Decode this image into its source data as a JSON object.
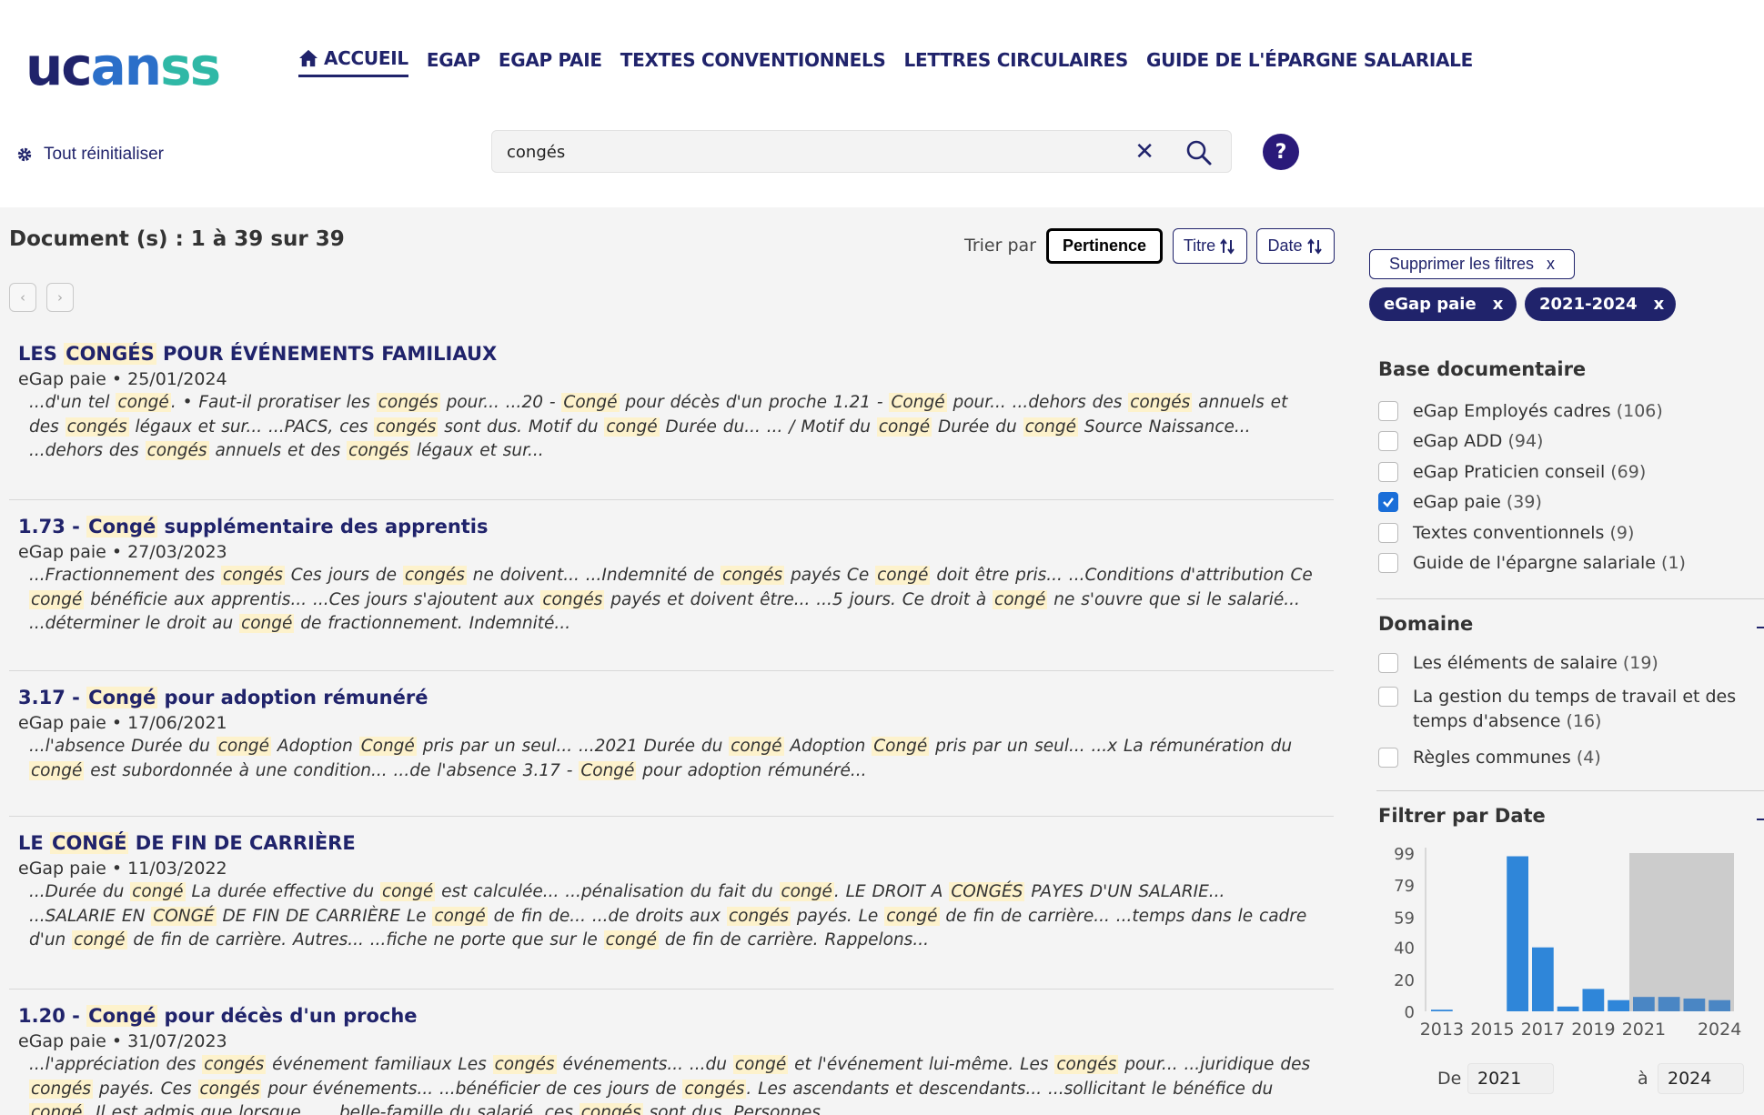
{
  "header": {
    "logo": {
      "part1": "uc",
      "part2": "an",
      "part3": "ss"
    },
    "nav": [
      {
        "label": "ACCUEIL",
        "active": true,
        "icon": "home-icon"
      },
      {
        "label": "EGAP"
      },
      {
        "label": "EGAP PAIE"
      },
      {
        "label": "TEXTES CONVENTIONNELS"
      },
      {
        "label": "LETTRES CIRCULAIRES"
      },
      {
        "label": "GUIDE DE L'ÉPARGNE SALARIALE"
      }
    ],
    "reset_label": "Tout réinitialiser",
    "search": {
      "value": "congés",
      "clear_symbol": "✕"
    },
    "help_symbol": "?"
  },
  "results_header": {
    "count_text": "Document (s) : 1 à 39 sur 39",
    "sort_label": "Trier par",
    "sort_options": [
      "Pertinence",
      "Titre",
      "Date"
    ],
    "sort_active": "Pertinence",
    "pager": {
      "prev": "‹",
      "next": "›"
    }
  },
  "results": [
    {
      "title": [
        {
          "t": "LES "
        },
        {
          "t": "CONGÉS",
          "h": true
        },
        {
          "t": " POUR ÉVÉNEMENTS FAMILIAUX"
        }
      ],
      "meta": "eGap paie • 25/01/2024",
      "snippet": [
        {
          "t": "...d'un tel "
        },
        {
          "t": "congé",
          "h": true
        },
        {
          "t": ". • Faut-il proratiser les "
        },
        {
          "t": "congés",
          "h": true
        },
        {
          "t": " pour...    ...20 - "
        },
        {
          "t": "Congé",
          "h": true
        },
        {
          "t": " pour décès d'un proche 1.21 - "
        },
        {
          "t": "Congé",
          "h": true
        },
        {
          "t": " pour...    ...dehors des "
        },
        {
          "t": "congés",
          "h": true
        },
        {
          "t": " annuels et des "
        },
        {
          "t": "congés",
          "h": true
        },
        {
          "t": " légaux et sur...    ...PACS, ces "
        },
        {
          "t": "congés",
          "h": true
        },
        {
          "t": " sont dus. Motif du "
        },
        {
          "t": "congé",
          "h": true
        },
        {
          "t": " Durée du...    ... / Motif du "
        },
        {
          "t": "congé",
          "h": true
        },
        {
          "t": " Durée du "
        },
        {
          "t": "congé",
          "h": true
        },
        {
          "t": " Source Naissance...    ...dehors des "
        },
        {
          "t": "congés",
          "h": true
        },
        {
          "t": " annuels et des "
        },
        {
          "t": "congés",
          "h": true
        },
        {
          "t": " légaux et sur..."
        }
      ]
    },
    {
      "title": [
        {
          "t": "1.73 -  "
        },
        {
          "t": "Congé",
          "h": true
        },
        {
          "t": " supplémentaire des apprentis"
        }
      ],
      "meta": "eGap paie • 27/03/2023",
      "snippet": [
        {
          "t": "...Fractionnement des "
        },
        {
          "t": "congés",
          "h": true
        },
        {
          "t": " Ces jours de "
        },
        {
          "t": "congés",
          "h": true
        },
        {
          "t": " ne doivent...    ...Indemnité de "
        },
        {
          "t": "congés",
          "h": true
        },
        {
          "t": " payés Ce "
        },
        {
          "t": "congé",
          "h": true
        },
        {
          "t": " doit être pris...    ...Conditions d'attribution Ce "
        },
        {
          "t": "congé",
          "h": true
        },
        {
          "t": " bénéficie aux apprentis...    ...Ces jours s'ajoutent aux "
        },
        {
          "t": "congés",
          "h": true
        },
        {
          "t": " payés et doivent être...    ...5 jours. Ce droit à "
        },
        {
          "t": "congé",
          "h": true
        },
        {
          "t": " ne s'ouvre que si le salarié...    ...déterminer le droit au "
        },
        {
          "t": "congé",
          "h": true
        },
        {
          "t": " de fractionnement. Indemnité..."
        }
      ]
    },
    {
      "title": [
        {
          "t": "3.17 -  "
        },
        {
          "t": "Congé",
          "h": true
        },
        {
          "t": " pour adoption rémunéré"
        }
      ],
      "meta": "eGap paie • 17/06/2021",
      "snippet": [
        {
          "t": "...l'absence Durée du "
        },
        {
          "t": "congé",
          "h": true
        },
        {
          "t": " Adoption "
        },
        {
          "t": "Congé",
          "h": true
        },
        {
          "t": " pris par un seul...    ...2021 Durée du "
        },
        {
          "t": "congé",
          "h": true
        },
        {
          "t": " Adoption "
        },
        {
          "t": "Congé",
          "h": true
        },
        {
          "t": " pris par un seul...    ...x La rémunération du "
        },
        {
          "t": "congé",
          "h": true
        },
        {
          "t": " est subordonnée à une condition...    ...de l'absence 3.17 - "
        },
        {
          "t": "Congé",
          "h": true
        },
        {
          "t": " pour adoption rémunéré..."
        }
      ]
    },
    {
      "title": [
        {
          "t": "LE "
        },
        {
          "t": "CONGÉ",
          "h": true
        },
        {
          "t": " DE FIN DE CARRIÈRE"
        }
      ],
      "meta": "eGap paie • 11/03/2022",
      "snippet": [
        {
          "t": "...Durée du "
        },
        {
          "t": "congé",
          "h": true
        },
        {
          "t": " La durée effective du "
        },
        {
          "t": "congé",
          "h": true
        },
        {
          "t": " est calculée...    ...pénalisation du fait du "
        },
        {
          "t": "congé",
          "h": true
        },
        {
          "t": ". LE DROIT A "
        },
        {
          "t": "CONGÉS",
          "h": true
        },
        {
          "t": " PAYES D'UN SALARIE...    ...SALARIE EN "
        },
        {
          "t": "CONGÉ",
          "h": true
        },
        {
          "t": " DE FIN DE CARRIÈRE Le "
        },
        {
          "t": "congé",
          "h": true
        },
        {
          "t": " de fin de...    ...de droits aux "
        },
        {
          "t": "congés",
          "h": true
        },
        {
          "t": " payés. Le "
        },
        {
          "t": "congé",
          "h": true
        },
        {
          "t": " de fin de carrière...    ...temps dans le cadre d'un "
        },
        {
          "t": "congé",
          "h": true
        },
        {
          "t": " de fin de carrière. Autres...    ...fiche ne porte que sur le "
        },
        {
          "t": "congé",
          "h": true
        },
        {
          "t": " de fin de carrière. Rappelons..."
        }
      ]
    },
    {
      "title": [
        {
          "t": "1.20 -  "
        },
        {
          "t": "Congé",
          "h": true
        },
        {
          "t": " pour décès d'un proche"
        }
      ],
      "meta": "eGap paie • 31/07/2023",
      "snippet": [
        {
          "t": "...l'appréciation des "
        },
        {
          "t": "congés",
          "h": true
        },
        {
          "t": " événement familiaux Les "
        },
        {
          "t": "congés",
          "h": true
        },
        {
          "t": " événements...    ...du "
        },
        {
          "t": "congé",
          "h": true
        },
        {
          "t": " et l'événement lui-même. Les "
        },
        {
          "t": "congés",
          "h": true
        },
        {
          "t": " pour...    ...juridique des "
        },
        {
          "t": "congés",
          "h": true
        },
        {
          "t": " payés. Ces "
        },
        {
          "t": "congés",
          "h": true
        },
        {
          "t": " pour événements...    ...bénéficier de ces jours de "
        },
        {
          "t": "congés",
          "h": true
        },
        {
          "t": ". Les ascendants et descendants...    ...sollicitant le bénéfice du "
        },
        {
          "t": "congé",
          "h": true
        },
        {
          "t": ". Il est admis que lorsque...    ...belle-famille du salarié, ces "
        },
        {
          "t": "congés",
          "h": true
        },
        {
          "t": " sont dus. Personnes..."
        }
      ]
    }
  ],
  "filters": {
    "clear_label": "Supprimer les filtres",
    "close_symbol": "x",
    "active": [
      "eGap paie",
      "2021-2024"
    ],
    "base": {
      "title": "Base documentaire",
      "options": [
        {
          "label": "eGap Employés cadres",
          "count": "(106)",
          "checked": false
        },
        {
          "label": "eGap ADD",
          "count": "(94)",
          "checked": false
        },
        {
          "label": "eGap Praticien conseil",
          "count": "(69)",
          "checked": false
        },
        {
          "label": "eGap paie",
          "count": "(39)",
          "checked": true
        },
        {
          "label": "Textes conventionnels",
          "count": "(9)",
          "checked": false
        },
        {
          "label": "Guide de l'épargne salariale",
          "count": "(1)",
          "checked": false
        }
      ]
    },
    "domaine": {
      "title": "Domaine",
      "options": [
        {
          "label": "Les éléments de salaire",
          "count": "(19)",
          "checked": false
        },
        {
          "label": "La gestion du temps de travail et des",
          "label2": "temps d'absence",
          "count": "(16)",
          "checked": false
        },
        {
          "label": "Règles communes",
          "count": "(4)",
          "checked": false
        }
      ]
    },
    "date": {
      "title": "Filtrer par Date",
      "from_label": "De",
      "from_value": "2021",
      "to_label": "à",
      "to_value": "2024"
    }
  },
  "chart_data": {
    "type": "bar",
    "title": "",
    "x": [
      2013,
      2014,
      2015,
      2016,
      2017,
      2018,
      2019,
      2020,
      2021,
      2022,
      2023,
      2024
    ],
    "values": [
      1,
      0,
      0,
      97,
      40,
      3,
      14,
      7,
      9,
      9,
      8,
      7
    ],
    "selected_range": [
      2021,
      2024
    ],
    "ylim": [
      0,
      99
    ],
    "yticks": [
      0,
      20,
      40,
      59,
      79,
      99
    ],
    "xticks": [
      2013,
      2015,
      2017,
      2019,
      2021,
      2024
    ],
    "bar_color": "#2f86d9",
    "selected_bar_color": "#4a86c4",
    "selection_color": "#cccccc",
    "grid": false
  }
}
